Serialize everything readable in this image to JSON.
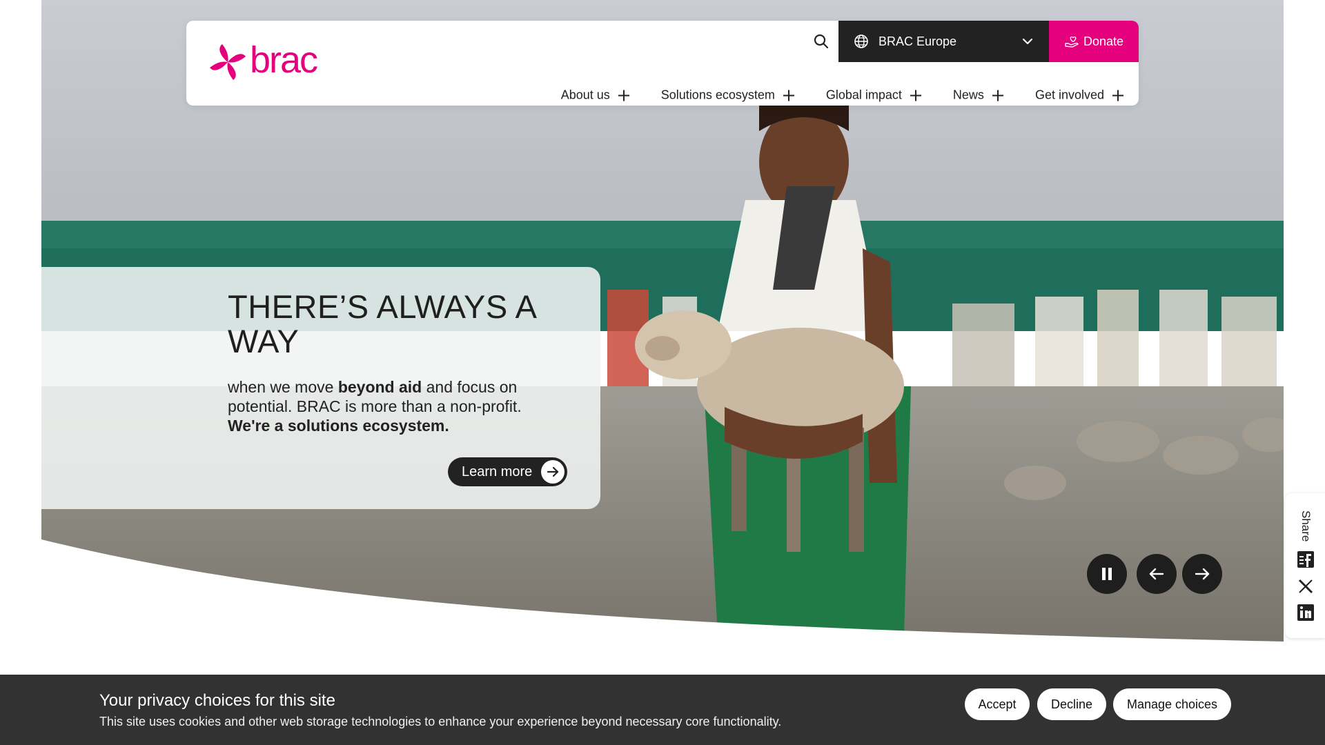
{
  "header": {
    "logo_text": "brac",
    "region_label": "BRAC Europe",
    "donate_label": "Donate",
    "nav": [
      {
        "label": "About us"
      },
      {
        "label": "Solutions ecosystem"
      },
      {
        "label": "Global impact"
      },
      {
        "label": "News"
      },
      {
        "label": "Get involved"
      }
    ]
  },
  "hero": {
    "title": "THERE’S ALWAYS A WAY",
    "body_pre": "when we move ",
    "body_bold1": "beyond aid",
    "body_mid": " and focus on potential. BRAC is more than a non-profit. ",
    "body_bold2": "We're a solutions ecosystem.",
    "cta_label": "Learn more"
  },
  "share": {
    "label": "Share",
    "icons": [
      "facebook-icon",
      "x-icon",
      "linkedin-icon"
    ]
  },
  "cookie": {
    "title": "Your privacy choices for this site",
    "text": "This site uses cookies and other web storage technologies to enhance your experience beyond necessary core functionality.",
    "accept_label": "Accept",
    "decline_label": "Decline",
    "manage_label": "Manage choices"
  },
  "colors": {
    "brand": "#e5007d",
    "dark": "#222222",
    "cookie_bg": "#323232"
  }
}
